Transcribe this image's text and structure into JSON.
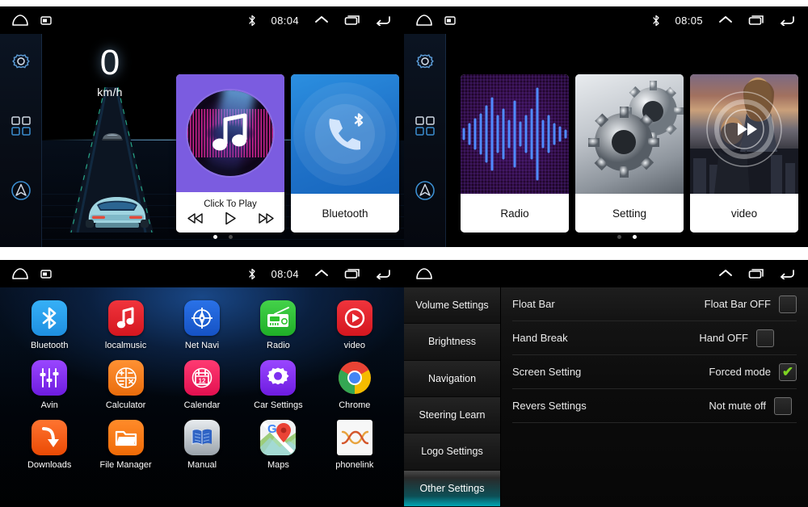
{
  "panels": {
    "home_page1": {
      "statusbar": {
        "clock": "08:04",
        "bluetooth_icon": "bluetooth-icon",
        "home_icon": "home-icon",
        "screenshot_icon": "screenshot-icon",
        "expand_icon": "chevron-up-icon",
        "recents_icon": "recents-icon",
        "back_icon": "back-icon"
      },
      "rail": {
        "settings": "gear-icon",
        "apps": "app-grid-icon",
        "navigation": "navigation-icon"
      },
      "speed": {
        "value": "0",
        "unit": "km/h"
      },
      "cards": [
        {
          "title": "Click To Play",
          "art": "music-disc",
          "controls": {
            "prev": "skip-back-icon",
            "play": "play-icon",
            "next": "skip-forward-icon"
          }
        },
        {
          "title": "Bluetooth",
          "art": "bluetooth-phone"
        }
      ],
      "dots": [
        {
          "active": true
        },
        {
          "active": false
        }
      ]
    },
    "home_page2": {
      "statusbar": {
        "clock": "08:05",
        "bluetooth_icon": "bluetooth-icon",
        "home_icon": "home-icon",
        "screenshot_icon": "screenshot-icon",
        "expand_icon": "chevron-up-icon",
        "recents_icon": "recents-icon",
        "back_icon": "back-icon"
      },
      "cards": [
        {
          "title": "Radio",
          "art": "audio-waveform"
        },
        {
          "title": "Setting",
          "art": "gears-photo"
        },
        {
          "title": "video",
          "art": "movie-poster"
        }
      ],
      "dots": [
        {
          "active": false
        },
        {
          "active": true
        }
      ]
    },
    "app_drawer": {
      "statusbar": {
        "clock": "08:04"
      },
      "apps": [
        {
          "label": "Bluetooth",
          "icon": "bluetooth-icon",
          "color": "#2196f3"
        },
        {
          "label": "localmusic",
          "icon": "music-note-icon",
          "color": "#e8232a"
        },
        {
          "label": "Net Navi",
          "icon": "compass-icon",
          "color": "#1e63d8"
        },
        {
          "label": "Radio",
          "icon": "radio-icon",
          "color": "#2ec32e"
        },
        {
          "label": "video",
          "icon": "play-circle-icon",
          "color": "#e8232a"
        },
        {
          "label": "Avin",
          "icon": "sliders-icon",
          "color": "#7e2ff0"
        },
        {
          "label": "Calculator",
          "icon": "calculator-icon",
          "color": "#f07c1f"
        },
        {
          "label": "Calendar",
          "icon": "calendar-icon",
          "color": "#e81e5a"
        },
        {
          "label": "Car Settings",
          "icon": "gear-icon",
          "color": "#7e2ff0"
        },
        {
          "label": "Chrome",
          "icon": "chrome-icon",
          "color": "#ffffff"
        },
        {
          "label": "Downloads",
          "icon": "download-icon",
          "color": "#f05a16"
        },
        {
          "label": "File Manager",
          "icon": "folder-icon",
          "color": "#f07018"
        },
        {
          "label": "Manual",
          "icon": "book-icon",
          "color": "#c8cdd2"
        },
        {
          "label": "Maps",
          "icon": "map-pin-icon",
          "color": "#f2f2f2"
        },
        {
          "label": "phonelink",
          "icon": "phonelink-icon",
          "color": "#f4f4f4"
        }
      ]
    },
    "settings": {
      "statusbar": {
        "home_icon": "home-icon",
        "expand_icon": "chevron-up-icon",
        "recents_icon": "recents-icon",
        "back_icon": "back-icon"
      },
      "tabs": [
        {
          "label": "Volume Settings",
          "active": false
        },
        {
          "label": "Brightness",
          "active": false
        },
        {
          "label": "Navigation",
          "active": false
        },
        {
          "label": "Steering Learn",
          "active": false
        },
        {
          "label": "Logo Settings",
          "active": false
        },
        {
          "label": "Other Settings",
          "active": true
        }
      ],
      "rows": [
        {
          "label": "Float Bar",
          "value": "Float Bar OFF",
          "checked": false
        },
        {
          "label": "Hand Break",
          "value": "Hand OFF",
          "checked": false
        },
        {
          "label": "Screen Setting",
          "value": "Forced mode",
          "checked": true
        },
        {
          "label": "Revers Settings",
          "value": "Not mute off",
          "checked": false
        }
      ],
      "check_glyph": "✔"
    }
  },
  "colors": {
    "accent_teal": "#00a7b5",
    "accent_blue": "#2196f3",
    "check_green": "#7ed321"
  }
}
